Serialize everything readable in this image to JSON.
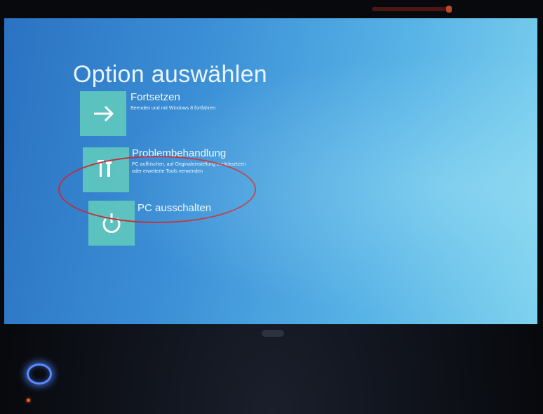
{
  "screen": {
    "title": "Option auswählen"
  },
  "options": [
    {
      "label": "Fortsetzen",
      "description": "Beenden und mit Windows 8 fortfahren",
      "icon": "arrow-right-icon"
    },
    {
      "label": "Problembehandlung",
      "description": "PC auffrischen, auf Originaleinstellung zurücksetzen oder erweiterte Tools verwenden",
      "icon": "tools-icon"
    },
    {
      "label": "PC ausschalten",
      "description": "",
      "icon": "power-icon"
    }
  ],
  "colors": {
    "tile": "#5cc2bf",
    "screen_background": "#3b8fd6",
    "highlight_ellipse": "#c0303a",
    "power_led": "#5a8cff"
  }
}
